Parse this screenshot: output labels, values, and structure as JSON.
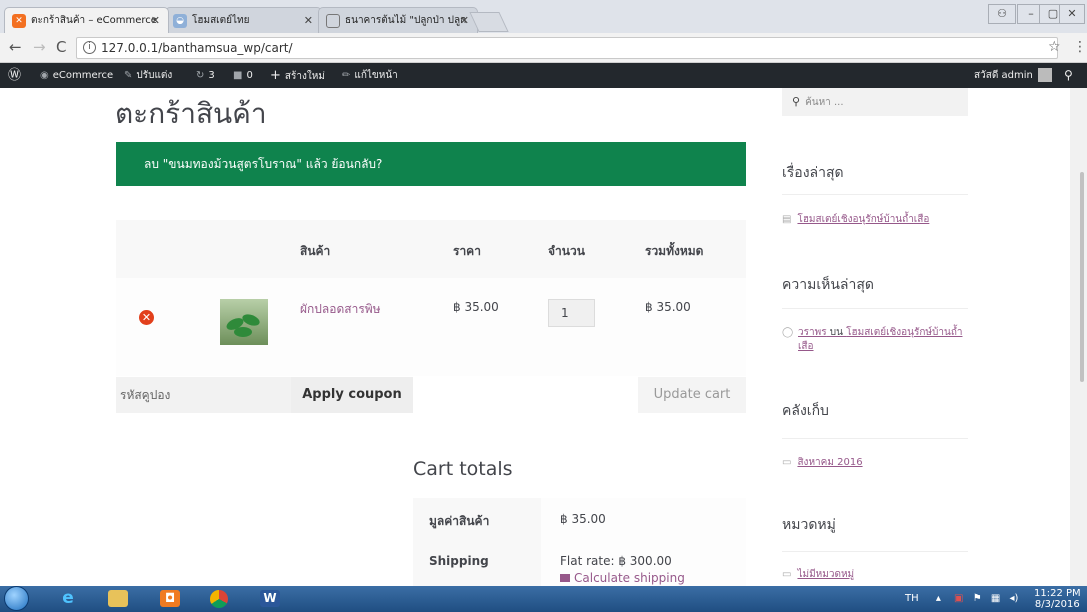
{
  "browser": {
    "tabs": [
      {
        "title": "ตะกร้าสินค้า – eCommerce",
        "active": true
      },
      {
        "title": "โฮมสเตย์ไทย",
        "active": false
      },
      {
        "title": "ธนาคารต้นไม้ \"ปลูกป่า ปลูก",
        "active": false
      }
    ],
    "url": "127.0.0.1/banthamsua_wp/cart/"
  },
  "adminbar": {
    "site_name": "eCommerce",
    "customize": "ปรับแต่ง",
    "updates": "3",
    "comments": "0",
    "new": "สร้างใหม่",
    "edit": "แก้ไขหน้า",
    "greeting": "สวัสดี admin"
  },
  "page": {
    "title": "ตะกร้าสินค้า",
    "notice": "ลบ \"ขนมทองม้วนสูตรโบราณ\" แล้ว ",
    "notice_undo": "ย้อนกลับ?"
  },
  "cart": {
    "headers": {
      "product": "สินค้า",
      "price": "ราคา",
      "quantity": "จำนวน",
      "total": "รวมทั้งหมด"
    },
    "item": {
      "name": "ผักปลอดสารพิษ",
      "price": "฿ 35.00",
      "quantity": "1",
      "subtotal": "฿ 35.00"
    },
    "coupon_placeholder": "รหัสคูปอง",
    "apply_coupon": "Apply coupon",
    "update_cart": "Update cart"
  },
  "totals": {
    "title": "Cart totals",
    "subtotal_label": "มูลค่าสินค้า",
    "subtotal_value": "฿ 35.00",
    "shipping_label": "Shipping",
    "shipping_value": "Flat rate: ฿ 300.00",
    "calc_shipping": "Calculate shipping"
  },
  "sidebar": {
    "search_placeholder": "ค้นหา ...",
    "recent_posts_title": "เรื่องล่าสุด",
    "recent_post": "โฮมสเตย์เชิงอนุรักษ์บ้านถ้ำเสือ",
    "recent_comments_title": "ความเห็นล่าสุด",
    "comment_author": "วราพร",
    "comment_on": " บน ",
    "comment_post": "โฮมสเตย์เชิงอนุรักษ์บ้านถ้ำเสือ",
    "archives_title": "คลังเก็บ",
    "archive_item": "สิงหาคม 2016",
    "categories_title": "หมวดหมู่",
    "category_item": "ไม่มีหมวดหมู่"
  },
  "taskbar": {
    "lang": "TH",
    "time": "11:22 PM",
    "date": "8/3/2016"
  },
  "colors": {
    "notice_bg": "#0f834d",
    "link": "#96588a",
    "remove": "#e2401c",
    "adminbar_bg": "#23282d"
  }
}
